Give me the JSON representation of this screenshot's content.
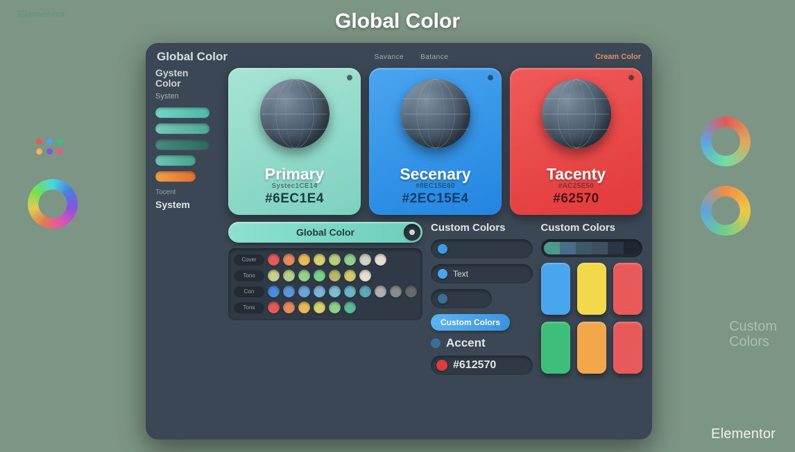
{
  "page_title": "Global Color",
  "ghost_label": "Elementor",
  "panel": {
    "title": "Global Color",
    "header_small_1": "Savance",
    "header_small_2": "Batance",
    "header_accent": "Cream Color"
  },
  "sidebar": {
    "heading_line1": "Gysten",
    "heading_line2": "Color",
    "sub": "Systen",
    "sliders": [
      {
        "bg": "linear-gradient(90deg,#6fd6c4,#4fb8a6)"
      },
      {
        "bg": "linear-gradient(90deg,#76c9b8,#4da893)"
      },
      {
        "bg": "linear-gradient(90deg,#4a8b7c,#2e6a5c)"
      },
      {
        "bg": "linear-gradient(90deg,#6cc6b2,#4aa38e)"
      },
      {
        "bg": "linear-gradient(90deg,#f0a046,#e07030)"
      }
    ],
    "label_small": "Tocent",
    "label": "System"
  },
  "cards": [
    {
      "title": "Primary",
      "sub": "Systec1CE14",
      "hex": "#6EC1E4",
      "cls": "c1"
    },
    {
      "title": "Secenary",
      "sub": "#8EC15E60",
      "hex": "#2EC15E4",
      "cls": "c2"
    },
    {
      "title": "Tacenty",
      "sub": "#AC25E50",
      "hex": "#62570",
      "cls": "c3"
    }
  ],
  "global_color_pill": "Global Color",
  "mid": {
    "heading": "Custom Colors",
    "pill1_color": "#3a9be8",
    "pill1_text": "",
    "pill2_color": "#4aa5ef",
    "pill2_text": "Text",
    "pill3_color": "#3a6e94",
    "cc_label": "Custom Colors",
    "accent_label": "Accent",
    "accent_dot": "#3a6e94",
    "hex_dot": "#e23a3a",
    "hex_value": "#612570"
  },
  "right": {
    "heading": "Custom Colors",
    "palette": [
      "#4a9a8e",
      "#4a6e8a",
      "#3e5868",
      "#3e5060",
      "#2a3642",
      "#1e2630"
    ],
    "tiles": [
      "#4aa5ef",
      "#f2d84a",
      "#e85a5a",
      "#3dbf7a",
      "#f2a84a",
      "#e85a5a"
    ]
  },
  "swatch_board": {
    "tags": [
      "Cover",
      "Tono",
      "Con",
      "Tons"
    ],
    "rows": [
      [
        "#e85a5a",
        "#e8895a",
        "#e8b85a",
        "#d8d06a",
        "#b8d07a",
        "#8cd08a",
        "#d0d0c8",
        "#e6ded2"
      ],
      [
        "#c8d08a",
        "#b8d08a",
        "#98d08a",
        "#78d08a",
        "#b8b86a",
        "#d8c86a",
        "#e6ded2"
      ],
      [
        "#4a8ad8",
        "#5a98d8",
        "#6aa6d8",
        "#7ab4d8",
        "#7abed0",
        "#6ab6c8",
        "#5ea8b8",
        "#b0b0b0",
        "#8a8a8a",
        "#6a6a6a"
      ],
      [
        "#e85a5a",
        "#e8895a",
        "#e8b85a",
        "#d8d06a",
        "#8cd08a",
        "#5ab89a"
      ]
    ]
  },
  "side_text_1": "Custom",
  "side_text_2": "Colors",
  "brand": "Elementor"
}
